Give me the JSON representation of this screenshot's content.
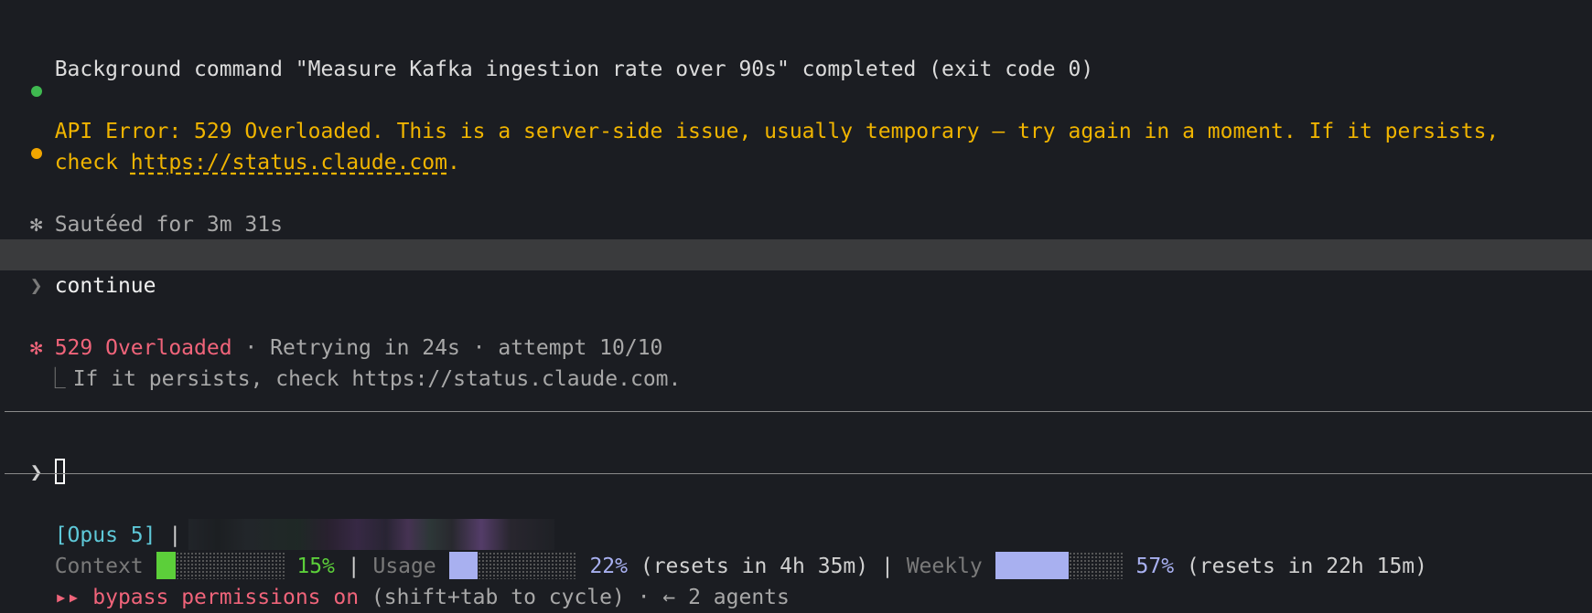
{
  "messages": {
    "bg_command": "Background command \"Measure Kafka ingestion rate over 90s\" completed (exit code 0)",
    "api_error_line1": "API Error: 529 Overloaded. This is a server-side issue, usually temporary — try again in a moment. If it persists,",
    "api_error_check": "check ",
    "api_error_link": "https://status.claude.com",
    "api_error_period": ".",
    "sauteed_symbol": "✻",
    "sauteed": "Sautéed for 3m 31s",
    "prompt_symbol": "❯",
    "user_input": "continue",
    "retry_symbol": "✻",
    "retry_status": "529 Overloaded",
    "retry_detail": " · Retrying in 24s · attempt 10/10",
    "retry_tree": "⎿",
    "retry_hint": "If it persists, check https://status.claude.com."
  },
  "input": {
    "prompt_symbol": "❯",
    "value": ""
  },
  "status": {
    "model": "[Opus 5]",
    "sep": "|",
    "context_label": "Context",
    "context_pct": "15%",
    "context_value": 0.15,
    "usage_label": "Usage",
    "usage_pct": "22%",
    "usage_value": 0.22,
    "usage_reset": "(resets in 4h 35m)",
    "weekly_label": "Weekly",
    "weekly_pct": "57%",
    "weekly_value": 0.57,
    "weekly_reset": "(resets in 22h 15m)",
    "bypass_arrows": "▸▸",
    "bypass_text": "bypass permissions on",
    "bypass_hint": " (shift+tab to cycle) · ← 2 agents"
  },
  "colors": {
    "background": "#1b1d22",
    "success": "#3fb950",
    "warning": "#f0b400",
    "error": "#f0647a",
    "model": "#5ec8d8",
    "usage": "#a8b0f0",
    "context": "#5ccf3a"
  }
}
